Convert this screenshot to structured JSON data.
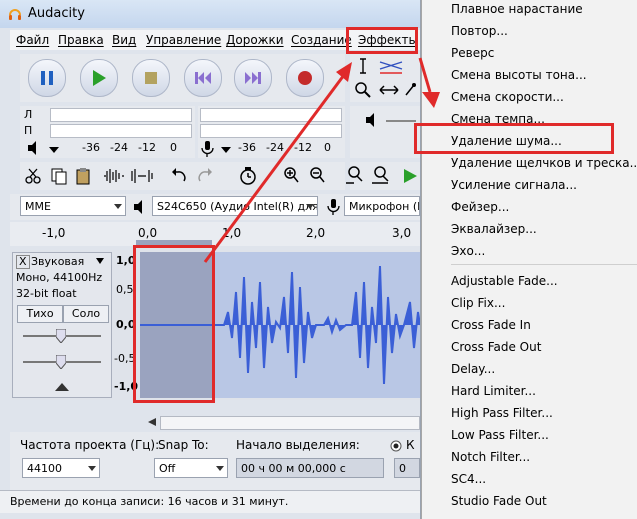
{
  "window": {
    "title": "Audacity"
  },
  "menubar": [
    "Файл",
    "Правка",
    "Вид",
    "Управление",
    "Дорожки",
    "Создание",
    "Эффекты"
  ],
  "meters": {
    "left_label": "Л",
    "right_label": "П",
    "ticks": [
      "-36",
      "-24",
      "-12",
      "0"
    ]
  },
  "devices": {
    "host": "MME",
    "output": "S24C650 (Аудио Intel(R) для",
    "input": "Микрофон (Н"
  },
  "ruler": [
    "-1,0",
    "0,0",
    "1,0",
    "2,0",
    "3,0"
  ],
  "track": {
    "name": "Звуковая",
    "close": "X",
    "info1": "Моно, 44100Hz",
    "info2": "32-bit float",
    "mute": "Тихо",
    "solo": "Соло",
    "scale": [
      "1,0",
      "0,5",
      "0,0",
      "-0,5",
      "-1,0"
    ]
  },
  "bottom": {
    "rate_label": "Частота проекта (Гц):",
    "rate_value": "44100",
    "snap_label": "Snap To:",
    "snap_value": "Off",
    "selection_label": "Начало выделения:",
    "selection_value": "00 ч 00 м 00,000 с",
    "selection_value2": "0",
    "radio_label": "К"
  },
  "status": "Времени до конца записи: 16 часов и 31 минут.",
  "effects_menu": {
    "items_a": [
      "Плавное нарастание",
      "Повтор...",
      "Реверс",
      "Смена высоты тона...",
      "Смена скорости...",
      "Смена темпа...",
      "Удаление шума...",
      "Удаление щелчков и треска...",
      "Усиление сигнала...",
      "Фейзер...",
      "Эквалайзер...",
      "Эхо..."
    ],
    "items_b": [
      "Adjustable Fade...",
      "Clip Fix...",
      "Cross Fade In",
      "Cross Fade Out",
      "Delay...",
      "Hard Limiter...",
      "High Pass Filter...",
      "Low Pass Filter...",
      "Notch Filter...",
      "SC4...",
      "Studio Fade Out"
    ],
    "highlighted": "Удаление шума..."
  },
  "colors": {
    "highlight": "#e02a2a",
    "waveform": "#3b5fd6",
    "selection": "#9aa3bf"
  }
}
